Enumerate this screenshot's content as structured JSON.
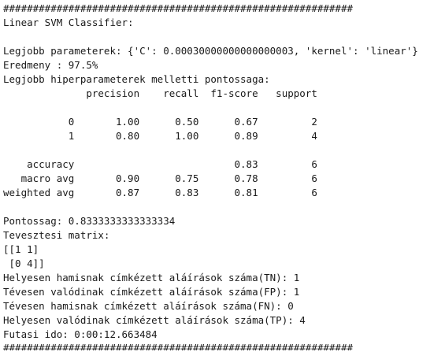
{
  "console": {
    "lines": [
      "###########################################################",
      "Linear SVM Classifier:",
      "",
      "Legjobb parameterek: {'C': 0.00030000000000000003, 'kernel': 'linear'}",
      "Eredmeny : 97.5%",
      "Legjobb hiperparameterek melletti pontossaga:",
      "              precision    recall  f1-score   support",
      "",
      "           0       1.00      0.50      0.67         2",
      "           1       0.80      1.00      0.89         4",
      "",
      "    accuracy                           0.83         6",
      "   macro avg       0.90      0.75      0.78         6",
      "weighted avg       0.87      0.83      0.81         6",
      "",
      "Pontossag: 0.8333333333333334",
      "Tevesztesi matrix:",
      "[[1 1]",
      " [0 4]]",
      "Helyesen hamisnak címkézett aláírások száma(TN): 1",
      "Tévesen valódinak címkézett aláírások száma(FP): 1",
      "Tévesen hamisnak címkézett aláírások száma(FN): 0",
      "Helyesen valódinak címkézett aláírások száma(TP): 4",
      "Futasi ido: 0:00:12.663484",
      "###########################################################"
    ]
  }
}
